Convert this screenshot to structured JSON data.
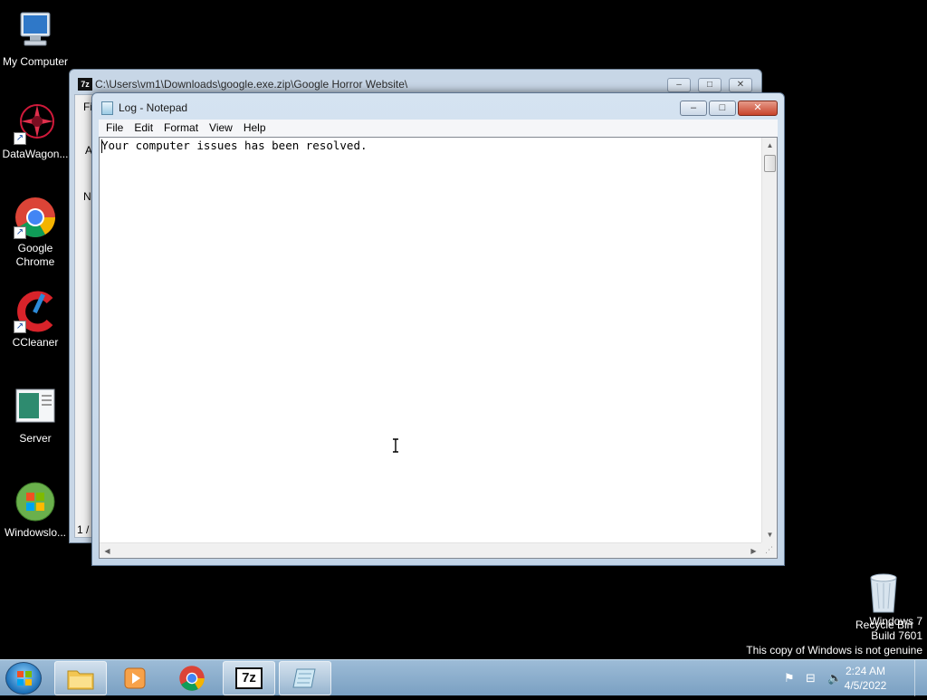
{
  "desktop": {
    "icons": [
      {
        "label": "My Computer"
      },
      {
        "label": "DataWagon..."
      },
      {
        "label": "Google\nChrome"
      },
      {
        "label": "CCleaner"
      },
      {
        "label": "Server"
      },
      {
        "label": "Windowslo..."
      }
    ],
    "recycle_bin": {
      "label": "Recycle Bin"
    },
    "watermark": {
      "line1": "Windows 7",
      "line2": "Build 7601",
      "line3": "This copy of Windows is not genuine"
    }
  },
  "zip_window": {
    "badge": "7z",
    "title": "C:\\Users\\vm1\\Downloads\\google.exe.zip\\Google Horror Website\\",
    "fragments": [
      "Fi",
      "A",
      "N",
      "1 /"
    ]
  },
  "notepad": {
    "title": "Log - Notepad",
    "menu": [
      "File",
      "Edit",
      "Format",
      "View",
      "Help"
    ],
    "content": "Your computer issues has been resolved."
  },
  "taskbar": {
    "clock_time": "2:24 AM",
    "clock_date": "4/5/2022",
    "zip_label": "7z"
  },
  "colors": {
    "taskbar": "#7aa0c2",
    "desktop": "#000000",
    "close_button": "#c8432b"
  }
}
